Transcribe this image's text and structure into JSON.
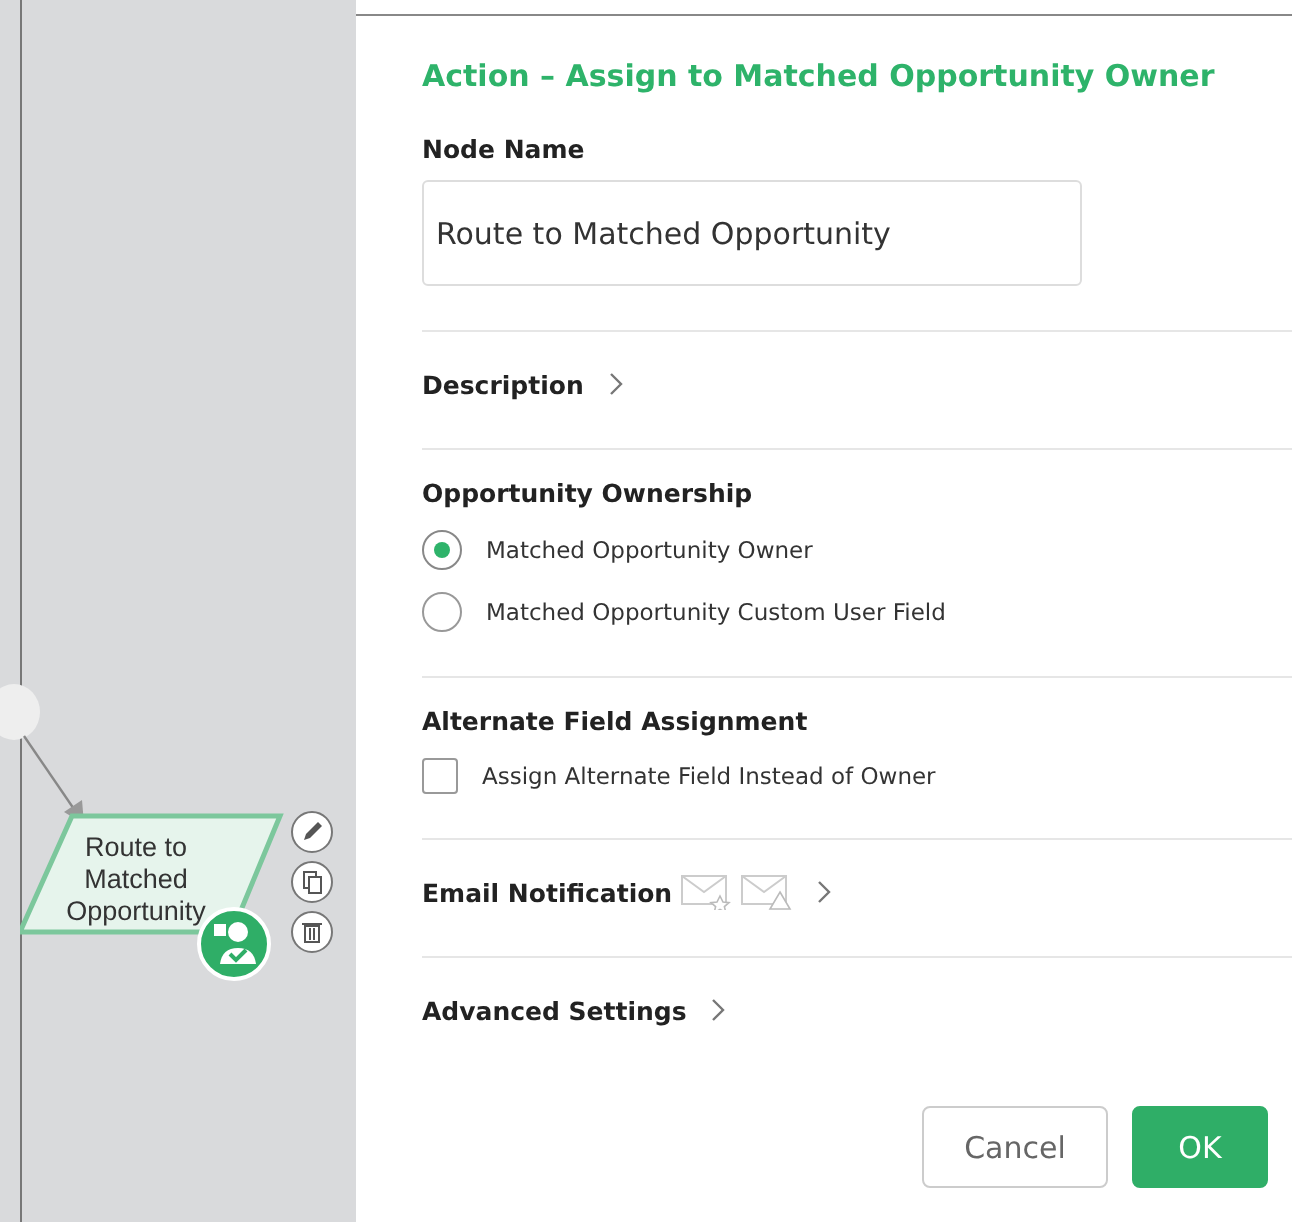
{
  "canvas": {
    "node": {
      "label": "Route to Matched Opportunity"
    }
  },
  "panel": {
    "title": "Action – Assign to Matched Opportunity Owner",
    "node_name": {
      "label": "Node Name",
      "value": "Route to Matched Opportunity"
    },
    "sections": [
      {
        "kind": "collapsible",
        "title": "Description"
      },
      {
        "kind": "radio",
        "title": "Opportunity Ownership",
        "options": [
          {
            "label": "Matched Opportunity Owner",
            "selected": true
          },
          {
            "label": "Matched Opportunity Custom User Field",
            "selected": false
          }
        ]
      },
      {
        "kind": "checkbox",
        "title": "Alternate Field Assignment",
        "options": [
          {
            "label": "Assign Alternate Field Instead of Owner",
            "checked": false
          }
        ]
      },
      {
        "kind": "email",
        "title": "Email Notification"
      },
      {
        "kind": "collapsible",
        "title": "Advanced Settings"
      }
    ],
    "buttons": [
      {
        "label": "Cancel",
        "kind": "secondary"
      },
      {
        "label": "OK",
        "kind": "primary"
      }
    ]
  }
}
